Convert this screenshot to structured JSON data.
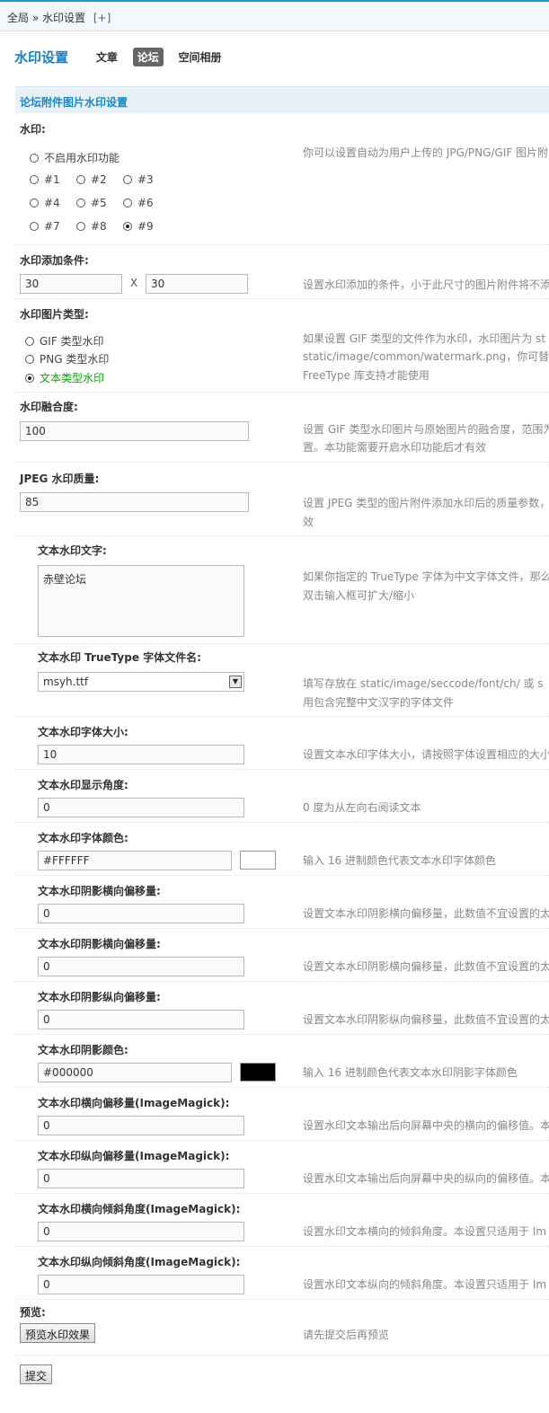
{
  "breadcrumb": {
    "root": "全局",
    "sep": "»",
    "current": "水印设置",
    "add": "[+]"
  },
  "page": {
    "title": "水印设置",
    "tabs": [
      {
        "label": "文章",
        "active": false
      },
      {
        "label": "论坛",
        "active": true
      },
      {
        "label": "空间相册",
        "active": false
      }
    ]
  },
  "section_title": "论坛附件图片水印设置",
  "watermark": {
    "label": "水印:",
    "off_label": "不启用水印功能",
    "positions": [
      "#1",
      "#2",
      "#3",
      "#4",
      "#5",
      "#6",
      "#7",
      "#8",
      "#9"
    ],
    "selected": "#9",
    "desc": "你可以设置自动为用户上传的 JPG/PNG/GIF 图片附"
  },
  "condition": {
    "label": "水印添加条件:",
    "width": "30",
    "sep": "X",
    "height": "30",
    "desc": "设置水印添加的条件，小于此尺寸的图片附件将不添"
  },
  "type": {
    "label": "水印图片类型:",
    "options": [
      "GIF 类型水印",
      "PNG 类型水印",
      "文本类型水印"
    ],
    "selected": "文本类型水印",
    "desc": [
      "如果设置 GIF 类型的文件作为水印，水印图片为 st",
      "static/image/common/watermark.png，你可替",
      "FreeType 库支持才能使用"
    ]
  },
  "blend": {
    "label": "水印融合度:",
    "value": "100",
    "desc": [
      "设置 GIF 类型水印图片与原始图片的融合度，范围为",
      "置。本功能需要开启水印功能后才有效"
    ]
  },
  "jpeg": {
    "label": "JPEG 水印质量:",
    "value": "85",
    "desc": [
      "设置 JPEG 类型的图片附件添加水印后的质量参数，",
      "效"
    ]
  },
  "text": {
    "label": "文本水印文字:",
    "value": "赤壁论坛",
    "desc": [
      "如果你指定的 TrueType 字体为中文字体文件，那么",
      "双击输入框可扩大/缩小"
    ]
  },
  "font": {
    "label": "文本水印 TrueType 字体文件名:",
    "value": "msyh.ttf",
    "desc": [
      "填写存放在 static/image/seccode/font/ch/ 或 s",
      "用包含完整中文汉字的字体文件"
    ]
  },
  "fields": [
    {
      "label": "文本水印字体大小:",
      "value": "10",
      "desc": "设置文本水印字体大小，请按照字体设置相应的大小"
    },
    {
      "label": "文本水印显示角度:",
      "value": "0",
      "desc": "0 度为从左向右阅读文本"
    },
    {
      "label": "文本水印字体颜色:",
      "value": "#FFFFFF",
      "desc": "输入 16 进制颜色代表文本水印字体颜色",
      "swatch": "#FFFFFF"
    },
    {
      "label": "文本水印阴影横向偏移量:",
      "value": "0",
      "desc": "设置文本水印阴影横向偏移量，此数值不宜设置的太"
    },
    {
      "label": "文本水印阴影横向偏移量:",
      "value": "0",
      "desc": "设置文本水印阴影横向偏移量，此数值不宜设置的太"
    },
    {
      "label": "文本水印阴影纵向偏移量:",
      "value": "0",
      "desc": "设置文本水印阴影纵向偏移量，此数值不宜设置的太"
    },
    {
      "label": "文本水印阴影颜色:",
      "value": "#000000",
      "desc": "输入 16 进制颜色代表文本水印阴影字体颜色",
      "swatch": "#000000"
    },
    {
      "label": "文本水印横向偏移量(ImageMagick):",
      "value": "0",
      "desc": "设置水印文本输出后向屏幕中央的横向的偏移值。本"
    },
    {
      "label": "文本水印纵向偏移量(ImageMagick):",
      "value": "0",
      "desc": "设置水印文本输出后向屏幕中央的纵向的偏移值。本"
    },
    {
      "label": "文本水印横向倾斜角度(ImageMagick):",
      "value": "0",
      "desc": "设置水印文本横向的倾斜角度。本设置只适用于 Im"
    },
    {
      "label": "文本水印纵向倾斜角度(ImageMagick):",
      "value": "0",
      "desc": "设置水印文本纵向的倾斜角度。本设置只适用于 Im"
    }
  ],
  "preview": {
    "label": "预览:",
    "button": "预览水印效果",
    "desc": "请先提交后再预览"
  },
  "submit": "提交"
}
